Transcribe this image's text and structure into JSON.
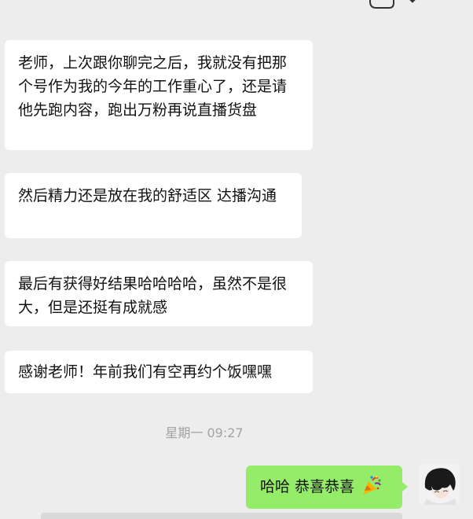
{
  "messages_in": [
    {
      "text": "老师，上次跟你聊完之后，我就没有把那个号作为我的今年的工作重心了，还是请他先跑内容，跑出万粉再说直播货盘"
    },
    {
      "text": "然后精力还是放在我的舒适区 达播沟通"
    },
    {
      "text": "最后有获得好结果哈哈哈哈，虽然不是很大，但是还挺有成就感"
    },
    {
      "text": "感谢老师！年前我们有空再约个饭嘿嘿"
    }
  ],
  "timestamp": "星期一 09:27",
  "message_out": {
    "text": "哈哈 恭喜恭喜",
    "emoji": "party-popper-icon"
  },
  "colors": {
    "background": "#ededed",
    "bubble_in": "#ffffff",
    "bubble_out": "#95ec69",
    "timestamp": "#a3a3a3"
  }
}
